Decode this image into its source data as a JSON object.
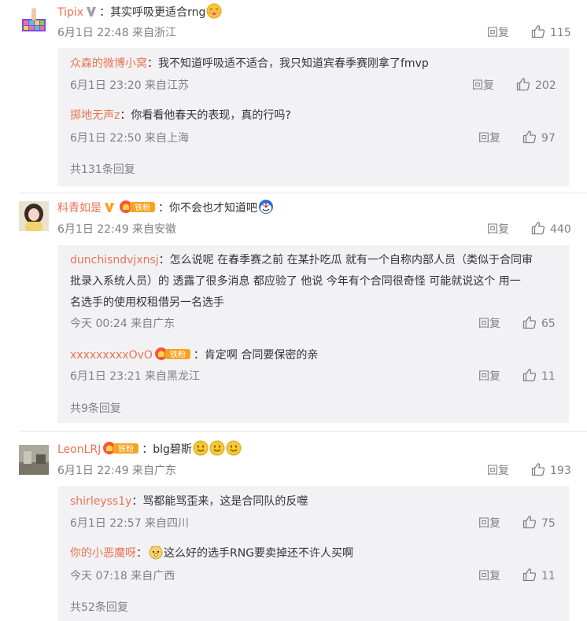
{
  "comments": [
    {
      "user": "Tipix",
      "sep": "：",
      "text": "其实呼吸更适合rng",
      "time": "6月1日 22:48 来自浙江",
      "reply_label": "回复",
      "likes": "115",
      "replies": [
        {
          "user": "众森的微博小窝",
          "sep": "：",
          "text": "我不知道呼吸适不适合，我只知道宾春季赛刚拿了fmvp",
          "time": "6月1日 23:20 来自江苏",
          "reply_label": "回复",
          "likes": "202"
        },
        {
          "user": "掷地无声z",
          "sep": "：",
          "text": "你看看他春天的表现，真的行吗?",
          "time": "6月1日 22:50 来自上海",
          "reply_label": "回复",
          "likes": "97"
        }
      ],
      "more": "共131条回复"
    },
    {
      "user": "料青如是",
      "fan_label": "铁粉",
      "sep": "：",
      "text": "你不会也才知道吧",
      "time": "6月1日 22:49 来自安徽",
      "reply_label": "回复",
      "likes": "440",
      "replies": [
        {
          "user": "dunchisndvjxnsj",
          "sep": "：",
          "text_lines": [
            "怎么说呢 在春季赛之前 在某扑吃瓜 就有一个自称内部人员（类似于合同审",
            "批录入系统人员）的 透露了很多消息 都应验了 他说 今年有个合同很奇怪 可能就说这个 用一",
            "名选手的使用权租借另一名选手"
          ],
          "time": "今天 00:24 来自广东",
          "reply_label": "回复",
          "likes": "65"
        },
        {
          "user": "xxxxxxxxxOvO",
          "fan_label": "铁粉",
          "sep": "：",
          "text": "肯定啊 合同要保密的亲",
          "time": "6月1日 23:21 来自黑龙江",
          "reply_label": "回复",
          "likes": "11"
        }
      ],
      "more": "共9条回复"
    },
    {
      "user": "LeonLRJ",
      "fan_label": "铁粉",
      "sep": "：",
      "text": "blg碧斯",
      "time": "6月1日 22:49 来自广东",
      "reply_label": "回复",
      "likes": "193",
      "replies": [
        {
          "user": "shirleyss1y",
          "sep": "：",
          "text": "骂都能骂歪来，这是合同队的反噬",
          "time": "6月1日 22:57 来自四川",
          "reply_label": "回复",
          "likes": "75"
        },
        {
          "user": "你的小恶魔呀",
          "sep": "：",
          "text": "这么好的选手RNG要卖掉还不许人买啊",
          "time": "今天 07:18 来自广西",
          "reply_label": "回复",
          "likes": "11"
        }
      ],
      "more": "共52条回复"
    }
  ],
  "colors": {
    "username": "#eb7350",
    "meta": "#808080",
    "reply_bg": "#f2f2f5",
    "v_badge": "#a0a0a0",
    "fan_badge": "#f7a221"
  },
  "icons": [
    "thumbs-up-icon",
    "vip-v-icon",
    "fan-badge-icon",
    "emoji-face-icon"
  ]
}
